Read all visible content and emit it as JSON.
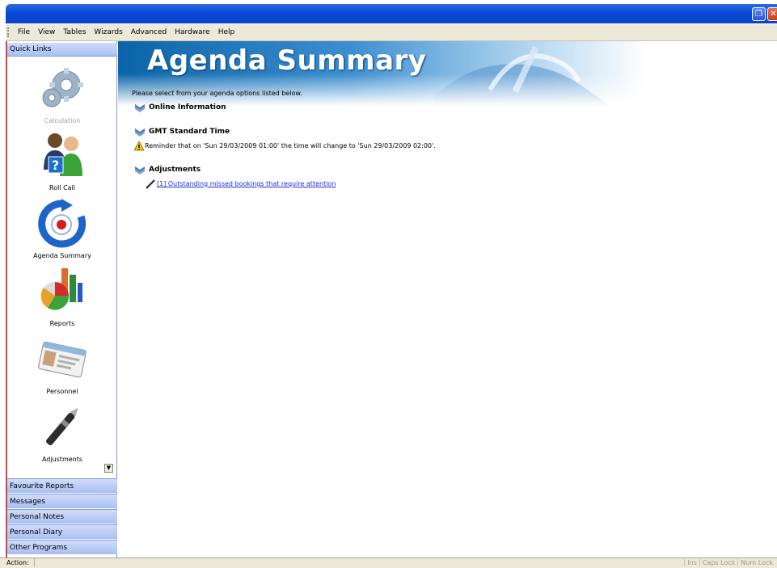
{
  "menu": {
    "items": [
      "File",
      "View",
      "Tables",
      "Wizards",
      "Advanced",
      "Hardware",
      "Help"
    ]
  },
  "window_buttons": {
    "restore_icon": "restore-icon",
    "close_icon": "close-icon"
  },
  "sidebar": {
    "header": "Quick Links",
    "items": [
      {
        "label": "Calculation",
        "icon": "gears-icon",
        "disabled": true
      },
      {
        "label": "Roll Call",
        "icon": "people-question-icon",
        "disabled": false
      },
      {
        "label": "Agenda Summary",
        "icon": "refresh-target-icon",
        "disabled": false
      },
      {
        "label": "Reports",
        "icon": "pie-bar-chart-icon",
        "disabled": false
      },
      {
        "label": "Personnel",
        "icon": "id-card-icon",
        "disabled": false
      },
      {
        "label": "Adjustments",
        "icon": "pen-icon",
        "disabled": false
      }
    ],
    "sections": [
      "Favourite Reports",
      "Messages",
      "Personal Notes",
      "Personal Diary",
      "Other Programs"
    ]
  },
  "main": {
    "title": "Agenda Summary",
    "intro": "Please select from your agenda options listed below.",
    "sections": [
      {
        "heading": "Online Information"
      },
      {
        "heading": "GMT Standard Time",
        "note": "Reminder that on 'Sun 29/03/2009 01:00' the time will change to 'Sun 29/03/2009 02:00'.",
        "note_icon": "warning-icon"
      },
      {
        "heading": "Adjustments",
        "link": "[1] Outstanding missed bookings that require attention",
        "link_icon": "pen-icon"
      }
    ]
  },
  "status": {
    "action_label": "Action:",
    "indicators": [
      "Ins",
      "Caps Lock",
      "Num Lock"
    ]
  },
  "colors": {
    "title_bar": "#0b49d6",
    "sidebar_section": "#b7caf5",
    "link": "#1a2fd8",
    "banner_blue": "#0b64a8"
  }
}
